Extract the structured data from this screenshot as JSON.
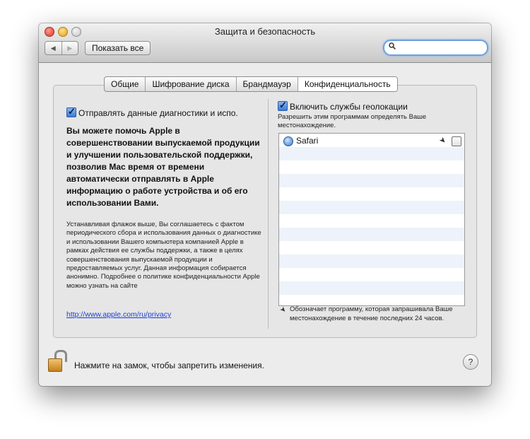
{
  "window": {
    "title": "Защита и безопасность"
  },
  "toolbar": {
    "back_icon": "◀",
    "forward_icon": "▶",
    "show_all_label": "Показать все",
    "search_placeholder": "",
    "search_icon": "search-icon"
  },
  "tabs": [
    {
      "label": "Общие",
      "active": false
    },
    {
      "label": "Шифрование диска",
      "active": false
    },
    {
      "label": "Брандмауэр",
      "active": false
    },
    {
      "label": "Конфиденциальность",
      "active": true
    }
  ],
  "left_panel": {
    "diagnostics_checkbox_label": "Отправлять данные диагностики и испо.",
    "diagnostics_checked": true,
    "bold_paragraph": "Вы можете помочь Apple в совершенствовании выпускаемой продукции и улучшении пользовательской поддержки, позволив Mac время от времени автоматически отправлять в Apple информацию о работе устройства и об его использовании Вами.",
    "small_paragraph": "Устанавливая флажок выше, Вы соглашаетесь с фактом периодического сбора и использования данных о диагностике и использовании Вашего компьютера компанией Apple в рамках действия ее службы поддержки, а также в целях совершенствования выпускаемой продукции и предоставляемых услуг. Данная информация собирается анонимно. Подробнее о политике конфиденциальности Apple можно узнать на сайте",
    "privacy_link": "http://www.apple.com/ru/privacy"
  },
  "right_panel": {
    "location_checkbox_label": "Включить службы геолокации",
    "location_checked": true,
    "location_subtitle": "Разрешить этим программам определять Ваше местонахождение.",
    "apps": [
      {
        "name": "Safari",
        "recent_location": true,
        "allowed": false
      }
    ],
    "legend_text": "Обозначает программу, которая запрашивала Ваше местонахождение в течение последних 24 часов."
  },
  "footer": {
    "lock_text": "Нажмите на замок, чтобы запретить изменения.",
    "help_label": "?"
  },
  "colors": {
    "accent": "#3a7ad6",
    "link": "#1a3fd8",
    "window_bg": "#ececec"
  }
}
